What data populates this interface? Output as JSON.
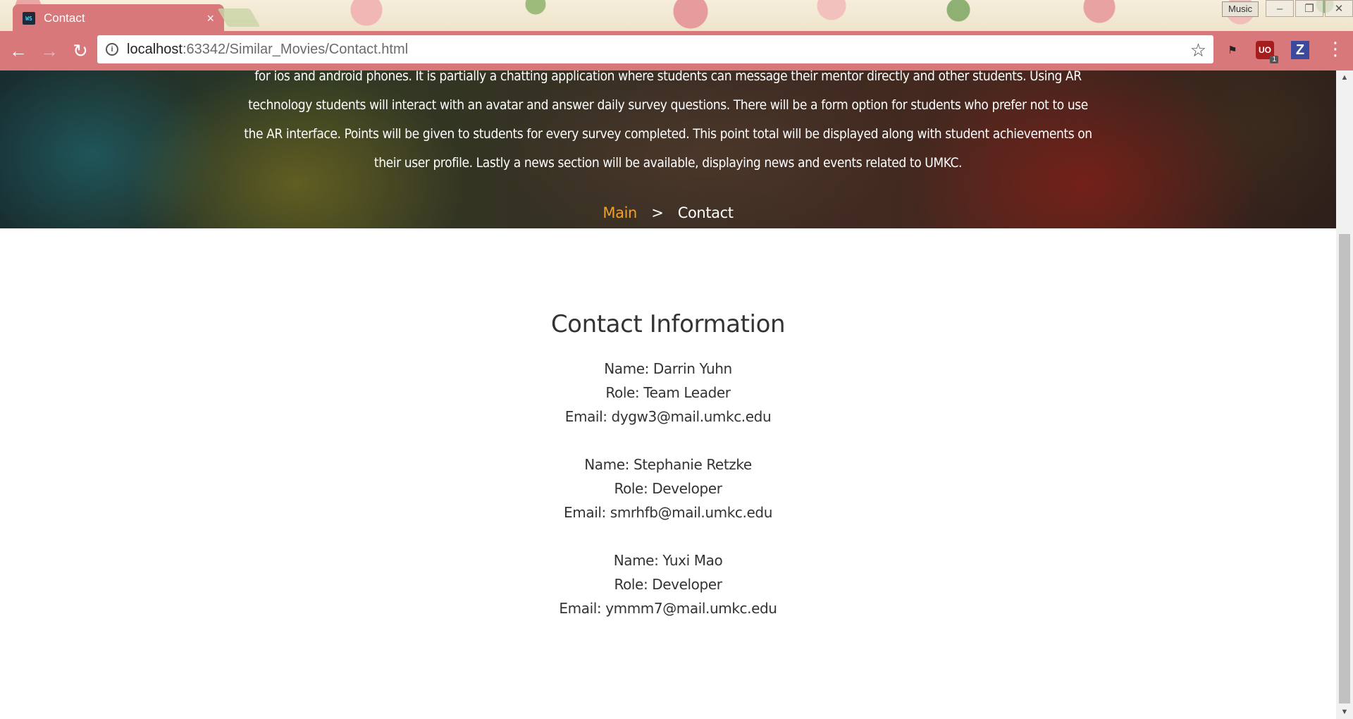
{
  "browser": {
    "tab_title": "Contact",
    "tab_favicon_text": "WS",
    "tab_close": "×",
    "music_button": "Music",
    "url_host": "localhost",
    "url_rest": ":63342/Similar_Movies/Contact.html",
    "extension_badge": "1",
    "extension_z": "Z",
    "extension_ub": "UO"
  },
  "hero": {
    "paragraph": "for ios and android phones. It is partially a chatting application where students can message their mentor directly and other students. Using AR technology students will interact with an avatar and answer daily survey questions. There will be a form option for students who prefer not to use the AR interface. Points will be given to students for every survey completed. This point total will be displayed along with student achievements on their user profile. Lastly a news section will be available, displaying news and events related to UMKC.",
    "breadcrumb_main": "Main",
    "breadcrumb_sep": ">",
    "breadcrumb_current": "Contact"
  },
  "contact": {
    "title": "Contact Information",
    "people": [
      {
        "name": "Name: Darrin Yuhn",
        "role": "Role: Team Leader",
        "email": "Email: dygw3@mail.umkc.edu"
      },
      {
        "name": "Name: Stephanie Retzke",
        "role": "Role: Developer",
        "email": "Email: smrhfb@mail.umkc.edu"
      },
      {
        "name": "Name: Yuxi Mao",
        "role": "Role: Developer",
        "email": "Email: ymmm7@mail.umkc.edu"
      }
    ]
  },
  "colors": {
    "browser_frame": "#d8787a",
    "breadcrumb_link": "#f0a030",
    "body_text": "#333333"
  },
  "icons": [
    "back-arrow-icon",
    "forward-arrow-icon",
    "reload-icon",
    "info-icon",
    "star-icon",
    "menu-icon",
    "close-icon"
  ]
}
